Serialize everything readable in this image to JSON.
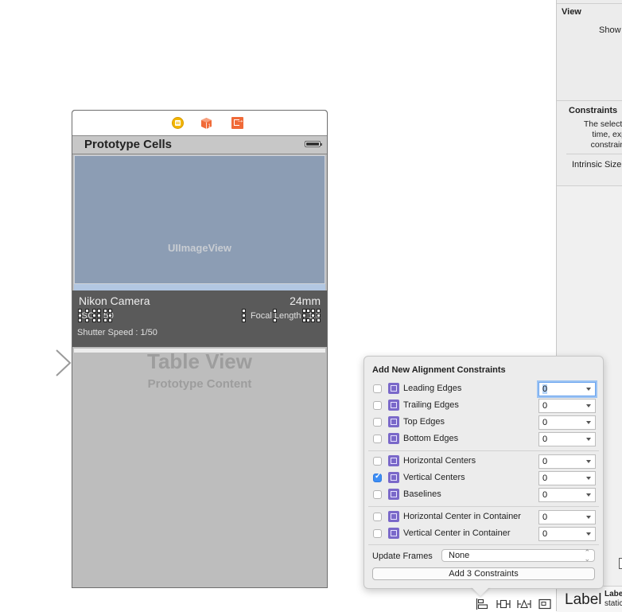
{
  "canvas": {
    "scene": {
      "dock_icons": [
        "view-controller-icon",
        "first-responder-icon",
        "exit-icon"
      ],
      "nav_title": "Prototype Cells",
      "image_view_label": "UIImageView",
      "cell": {
        "title": "Nikon Camera",
        "focal_mm": "24mm",
        "iso": "ISO : 50",
        "focal_length": "Focal Length : 1.8",
        "shutter_speed": "Shutter Speed :  1/50"
      },
      "table_view_title": "Table View",
      "table_view_subtitle": "Prototype Content"
    }
  },
  "inspector": {
    "view_section_title": "View",
    "show_label": "Show",
    "constraints_title": "Constraints",
    "constraints_text": [
      "The selected v",
      "time, expli",
      "constraints"
    ],
    "intrinsic_size_label": "Intrinsic Size",
    "library_item": {
      "big_label": "Label",
      "name": "Label",
      "description": "static"
    }
  },
  "popover": {
    "title": "Add New Alignment Constraints",
    "groups": [
      [
        {
          "label": "Leading Edges",
          "checked": false,
          "value": "0",
          "icon": "leading-edges-icon",
          "focused": true
        },
        {
          "label": "Trailing Edges",
          "checked": false,
          "value": "0",
          "icon": "trailing-edges-icon"
        },
        {
          "label": "Top Edges",
          "checked": false,
          "value": "0",
          "icon": "top-edges-icon"
        },
        {
          "label": "Bottom Edges",
          "checked": false,
          "value": "0",
          "icon": "bottom-edges-icon"
        }
      ],
      [
        {
          "label": "Horizontal Centers",
          "checked": false,
          "value": "0",
          "icon": "horizontal-centers-icon"
        },
        {
          "label": "Vertical Centers",
          "checked": true,
          "value": "0",
          "icon": "vertical-centers-icon"
        },
        {
          "label": "Baselines",
          "checked": false,
          "value": "0",
          "icon": "baselines-icon"
        }
      ],
      [
        {
          "label": "Horizontal Center in Container",
          "checked": false,
          "value": "0",
          "icon": "horizontal-center-container-icon"
        },
        {
          "label": "Vertical Center in Container",
          "checked": false,
          "value": "0",
          "icon": "vertical-center-container-icon"
        }
      ]
    ],
    "update_frames_label": "Update Frames",
    "update_frames_value": "None",
    "add_button_label": "Add 3 Constraints"
  },
  "toolbar": {
    "icons": [
      {
        "name": "align-icon",
        "glyph": "⊫"
      },
      {
        "name": "pin-icon",
        "glyph": "⊢⊣"
      },
      {
        "name": "resolve-issues-icon",
        "glyph": "⊢△"
      },
      {
        "name": "resizing-behavior-icon",
        "glyph": "⊡"
      }
    ]
  },
  "colors": {
    "image_view": "#8c9db4",
    "cell_background": "#5a5a5a",
    "table_background": "#bdbdbd",
    "constraint_icon": "#7a68c9",
    "checkbox_checked": "#3d8ef5",
    "focus_ring": "#9cc3f3"
  }
}
